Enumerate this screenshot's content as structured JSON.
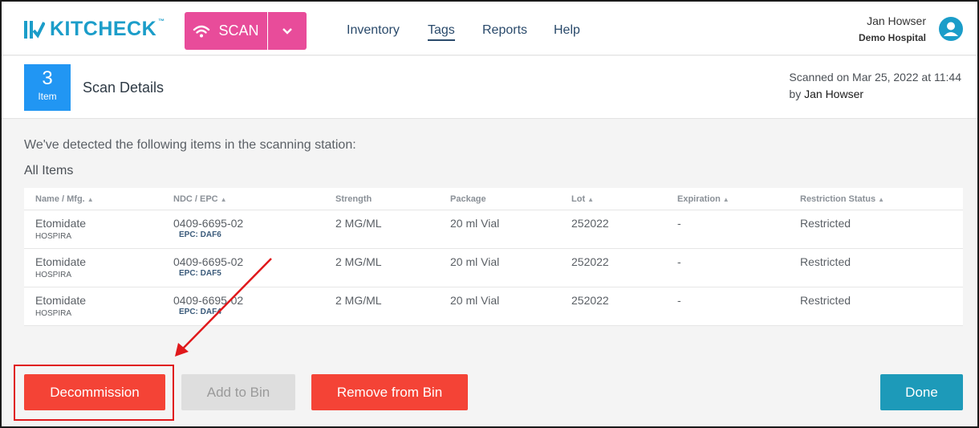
{
  "header": {
    "logo_text": "KITCHECK",
    "logo_tm": "™",
    "scan_label": "SCAN",
    "nav": [
      "Inventory",
      "Tags",
      "Reports",
      "Help"
    ],
    "active_nav": "Tags",
    "user_name": "Jan Howser",
    "user_org": "Demo Hospital"
  },
  "details": {
    "count": "3",
    "count_unit": "Item",
    "title": "Scan Details",
    "scanned_line": "Scanned on Mar 25, 2022 at 11:44",
    "by_prefix": "by",
    "by_name": "Jan Howser"
  },
  "body": {
    "intro": "We've detected the following items in the scanning station:",
    "section_title": "All Items"
  },
  "table": {
    "columns": [
      "Name / Mfg.",
      "NDC / EPC",
      "Strength",
      "Package",
      "Lot",
      "Expiration",
      "Restriction Status"
    ],
    "rows": [
      {
        "name": "Etomidate",
        "mfg": "HOSPIRA",
        "ndc": "0409-6695-02",
        "epc": "EPC: DAF6",
        "strength": "2 MG/ML",
        "package": "20 ml Vial",
        "lot": "252022",
        "expiration": "-",
        "restriction": "Restricted"
      },
      {
        "name": "Etomidate",
        "mfg": "HOSPIRA",
        "ndc": "0409-6695-02",
        "epc": "EPC: DAF5",
        "strength": "2 MG/ML",
        "package": "20 ml Vial",
        "lot": "252022",
        "expiration": "-",
        "restriction": "Restricted"
      },
      {
        "name": "Etomidate",
        "mfg": "HOSPIRA",
        "ndc": "0409-6695-02",
        "epc": "EPC: DAF4",
        "strength": "2 MG/ML",
        "package": "20 ml Vial",
        "lot": "252022",
        "expiration": "-",
        "restriction": "Restricted"
      }
    ]
  },
  "actions": {
    "decommission": "Decommission",
    "add_to_bin": "Add to Bin",
    "remove_from_bin": "Remove from Bin",
    "done": "Done"
  },
  "colors": {
    "brand": "#1b9dc9",
    "scan_pink": "#e84c9a",
    "danger": "#f44336",
    "done": "#1d9ab9",
    "count_blue": "#2196f3",
    "annotation_red": "#e0181b"
  }
}
